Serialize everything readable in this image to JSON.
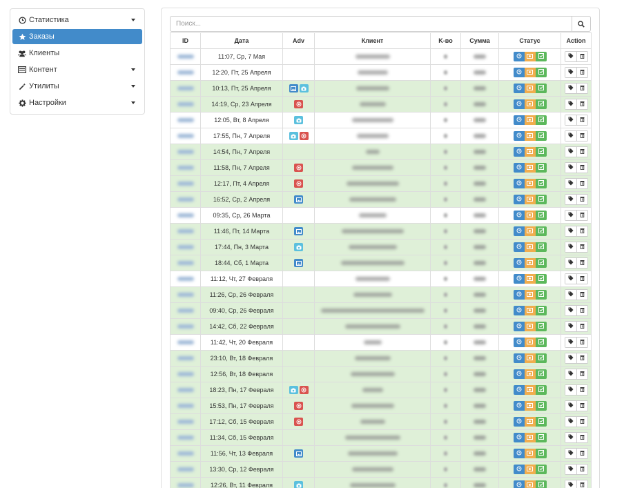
{
  "sidebar": {
    "items": [
      {
        "label": "Статистика",
        "icon": "clock-icon",
        "has_caret": true,
        "active": false
      },
      {
        "label": "Заказы",
        "icon": "star-icon",
        "has_caret": false,
        "active": true
      },
      {
        "label": "Клиенты",
        "icon": "users-icon",
        "has_caret": false,
        "active": false
      },
      {
        "label": "Контент",
        "icon": "list-icon",
        "has_caret": true,
        "active": false
      },
      {
        "label": "Утилиты",
        "icon": "wand-icon",
        "has_caret": true,
        "active": false
      },
      {
        "label": "Настройки",
        "icon": "gear-icon",
        "has_caret": true,
        "active": false
      }
    ]
  },
  "search": {
    "placeholder": "Поиск..."
  },
  "table": {
    "columns": [
      "ID",
      "Дата",
      "Adv",
      "Клиент",
      "K-во",
      "Сумма",
      "Статус",
      "Action"
    ],
    "rows": [
      {
        "date": "11:07, Ср, 7 Мая",
        "adv": [],
        "green": false
      },
      {
        "date": "12:20, Пт, 25 Апреля",
        "adv": [],
        "green": false
      },
      {
        "date": "10:13, Пт, 25 Апреля",
        "adv": [
          "blue",
          "info"
        ],
        "green": true
      },
      {
        "date": "14:19, Ср, 23 Апреля",
        "adv": [
          "red"
        ],
        "green": true
      },
      {
        "date": "12:05, Вт, 8 Апреля",
        "adv": [
          "info"
        ],
        "green": false
      },
      {
        "date": "17:55, Пн, 7 Апреля",
        "adv": [
          "info",
          "red"
        ],
        "green": false
      },
      {
        "date": "14:54, Пн, 7 Апреля",
        "adv": [],
        "green": true
      },
      {
        "date": "11:58, Пн, 7 Апреля",
        "adv": [
          "red"
        ],
        "green": true
      },
      {
        "date": "12:17, Пт, 4 Апреля",
        "adv": [
          "red"
        ],
        "green": true
      },
      {
        "date": "16:52, Ср, 2 Апреля",
        "adv": [
          "blue"
        ],
        "green": true
      },
      {
        "date": "09:35, Ср, 26 Марта",
        "adv": [],
        "green": false
      },
      {
        "date": "11:46, Пт, 14 Марта",
        "adv": [
          "blue"
        ],
        "green": true
      },
      {
        "date": "17:44, Пн, 3 Марта",
        "adv": [
          "info"
        ],
        "green": true
      },
      {
        "date": "18:44, Сб, 1 Марта",
        "adv": [
          "blue"
        ],
        "green": true
      },
      {
        "date": "11:12, Чт, 27 Февраля",
        "adv": [],
        "green": false
      },
      {
        "date": "11:26, Ср, 26 Февраля",
        "adv": [],
        "green": true
      },
      {
        "date": "09:40, Ср, 26 Февраля",
        "adv": [],
        "green": true
      },
      {
        "date": "14:42, Сб, 22 Февраля",
        "adv": [],
        "green": true
      },
      {
        "date": "11:42, Чт, 20 Февраля",
        "adv": [],
        "green": false
      },
      {
        "date": "23:10, Вт, 18 Февраля",
        "adv": [],
        "green": true
      },
      {
        "date": "12:56, Вт, 18 Февраля",
        "adv": [],
        "green": true
      },
      {
        "date": "18:23, Пн, 17 Февраля",
        "adv": [
          "info",
          "red"
        ],
        "green": true
      },
      {
        "date": "15:53, Пн, 17 Февраля",
        "adv": [
          "red"
        ],
        "green": true
      },
      {
        "date": "17:12, Сб, 15 Февраля",
        "adv": [
          "red"
        ],
        "green": true
      },
      {
        "date": "11:34, Сб, 15 Февраля",
        "adv": [],
        "green": true
      },
      {
        "date": "11:56, Чт, 13 Февраля",
        "adv": [
          "blue"
        ],
        "green": true
      },
      {
        "date": "13:30, Ср, 12 Февраля",
        "adv": [],
        "green": true
      },
      {
        "date": "12:26, Вт, 11 Февраля",
        "adv": [
          "info"
        ],
        "green": true
      }
    ]
  },
  "colors": {
    "active_nav": "#428bca",
    "row_success": "#dff0d8",
    "status_blue": "#428bca",
    "status_orange": "#f0ad4e",
    "status_green": "#5cb85c",
    "adv_red": "#d9534f",
    "adv_info": "#5bc0de"
  }
}
